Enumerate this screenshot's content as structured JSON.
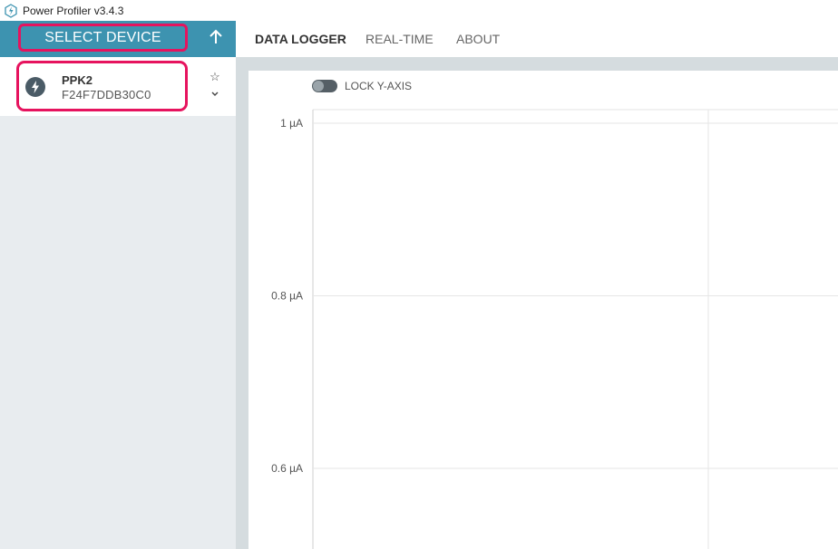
{
  "window": {
    "title": "Power Profiler v3.4.3",
    "app_icon": "power-profiler-icon"
  },
  "sidebar": {
    "select_device_label": "SELECT DEVICE",
    "collapse_icon": "arrow-up-icon",
    "device": {
      "name": "PPK2",
      "serial": "F24F7DDB30C0",
      "icon": "lightning-icon",
      "favorite_icon": "star-outline-icon",
      "expand_icon": "chevron-down-icon"
    }
  },
  "nav": {
    "tabs": [
      {
        "label": "DATA LOGGER",
        "active": true
      },
      {
        "label": "REAL-TIME",
        "active": false
      },
      {
        "label": "ABOUT",
        "active": false
      }
    ]
  },
  "chart_controls": {
    "lock_y_axis_label": "LOCK Y-AXIS",
    "lock_y_axis_on": false
  },
  "colors": {
    "accent": "#3d93b0",
    "highlight": "#e6135e",
    "sidebar_bg": "#e8ecef",
    "main_bg": "#d5dcdf"
  },
  "chart_data": {
    "type": "line",
    "y_ticks": [
      "1 µA",
      "0.8 µA",
      "0.6 µA"
    ],
    "y_tick_values": [
      1,
      0.8,
      0.6
    ],
    "series": [],
    "grid": true
  }
}
